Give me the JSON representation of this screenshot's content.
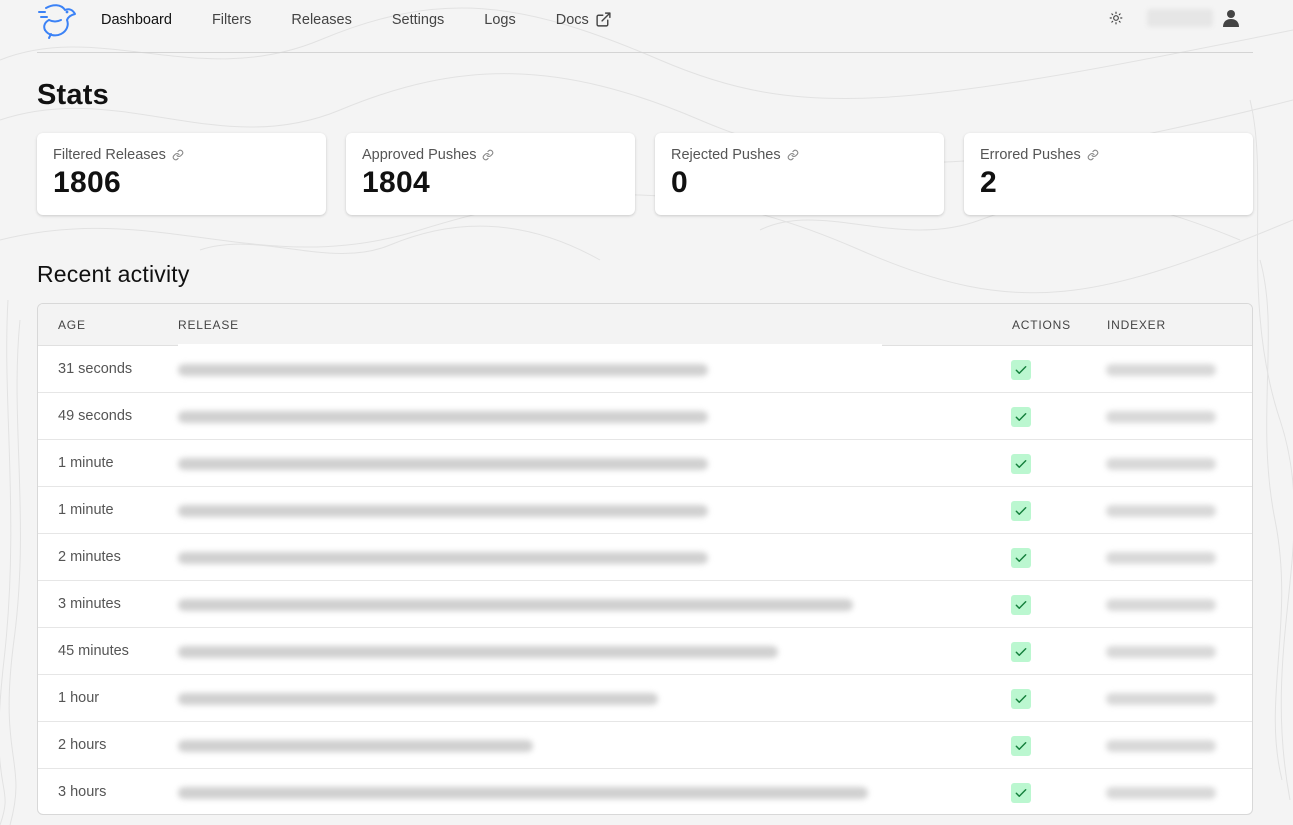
{
  "nav": {
    "items": [
      {
        "label": "Dashboard",
        "active": true
      },
      {
        "label": "Filters",
        "active": false
      },
      {
        "label": "Releases",
        "active": false
      },
      {
        "label": "Settings",
        "active": false
      },
      {
        "label": "Logs",
        "active": false
      },
      {
        "label": "Docs",
        "active": false,
        "external": true
      }
    ]
  },
  "stats": {
    "title": "Stats",
    "cards": [
      {
        "label": "Filtered Releases",
        "value": "1806"
      },
      {
        "label": "Approved Pushes",
        "value": "1804"
      },
      {
        "label": "Rejected Pushes",
        "value": "0"
      },
      {
        "label": "Errored Pushes",
        "value": "2"
      }
    ]
  },
  "recent": {
    "title": "Recent activity",
    "columns": {
      "age": "AGE",
      "release": "RELEASE",
      "actions": "ACTIONS",
      "indexer": "INDEXER"
    },
    "rows": [
      {
        "age": "31 seconds"
      },
      {
        "age": "49 seconds"
      },
      {
        "age": "1 minute"
      },
      {
        "age": "1 minute"
      },
      {
        "age": "2 minutes"
      },
      {
        "age": "3 minutes"
      },
      {
        "age": "45 minutes"
      },
      {
        "age": "1 hour"
      },
      {
        "age": "2 hours"
      },
      {
        "age": "3 hours"
      }
    ]
  },
  "colors": {
    "accent": "#3b82f6",
    "approved_bg": "#bbf7d0",
    "approved_check": "#15803d"
  }
}
